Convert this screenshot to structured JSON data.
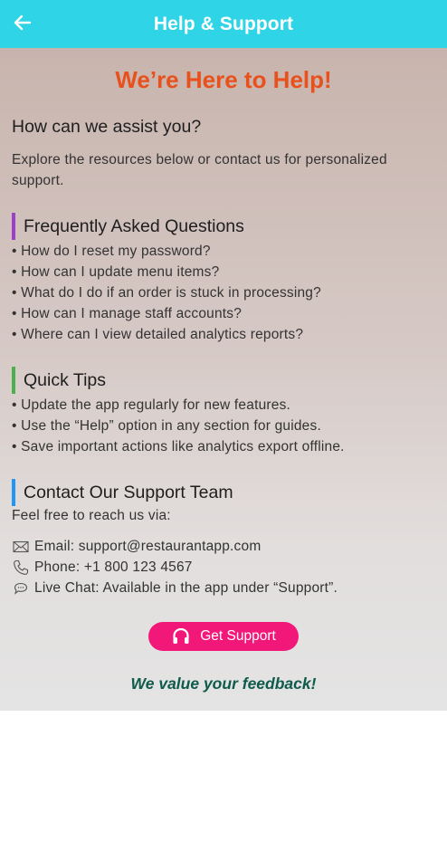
{
  "appbar": {
    "title": "Help & Support",
    "back_icon": "arrow-left-icon"
  },
  "headline": "We’re Here to Help!",
  "assist": {
    "title": "How can we assist you?",
    "description": "Explore the resources below or contact us for personalized support."
  },
  "faq": {
    "title": "Frequently Asked Questions",
    "accent": "#9c3fc9",
    "items": [
      "• How do I reset my password?",
      "• How can I update menu items?",
      "• What do I do if an order is stuck in processing?",
      "• How can I manage staff accounts?",
      "• Where can I view detailed analytics reports?"
    ]
  },
  "tips": {
    "title": "Quick Tips",
    "accent": "#4caf50",
    "items": [
      "• Update the app regularly for new features.",
      "• Use the “Help” option in any section for guides.",
      "• Save important actions like analytics export offline."
    ]
  },
  "contact": {
    "title": "Contact Our Support Team",
    "accent": "#2196f3",
    "intro": "Feel free to reach us via:",
    "email": "Email: support@restaurantapp.com",
    "phone": "Phone: +1 800 123 4567",
    "chat": "Live Chat: Available in the app under “Support”."
  },
  "support_button": {
    "label": "Get Support",
    "icon": "headset-icon"
  },
  "feedback": "We value your feedback!",
  "colors": {
    "appbar": "#2fd4e6",
    "headline": "#e8501c",
    "button": "#f2187a",
    "feedback": "#0f5a4a"
  }
}
